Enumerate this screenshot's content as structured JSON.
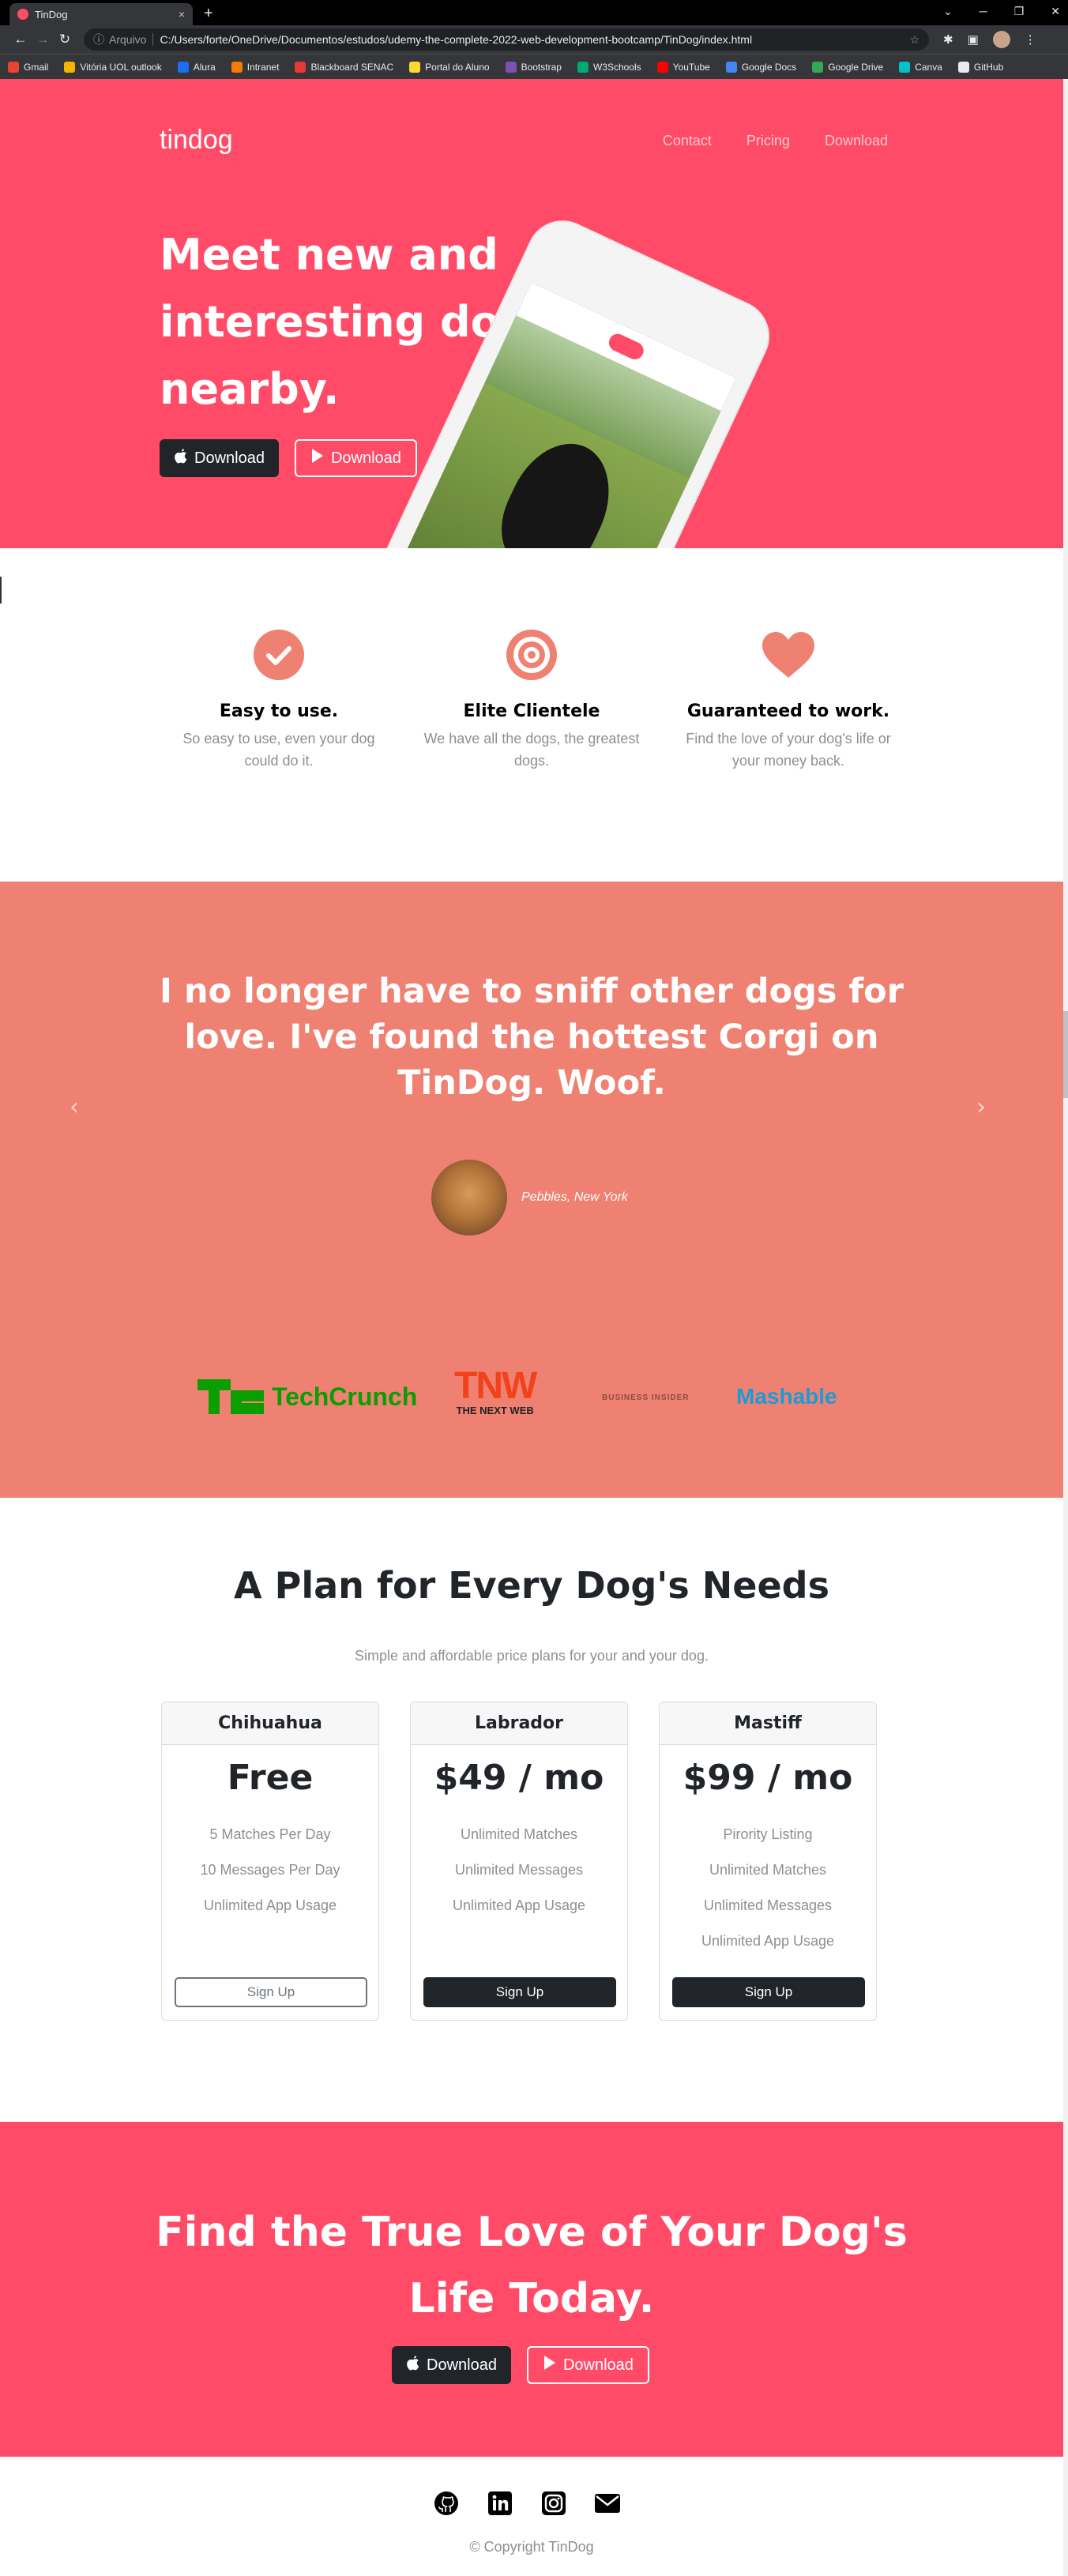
{
  "browser": {
    "tab_title": "TinDog",
    "tab_close": "×",
    "new_tab": "+",
    "url_scheme": "Arquivo",
    "url": "C:/Users/forte/OneDrive/Documentos/estudos/udemy-the-complete-2022-web-development-bootcamp/TinDog/index.html",
    "bookmarks": [
      {
        "label": "Gmail",
        "color": "#ea4335"
      },
      {
        "label": "Vitória UOL outlook",
        "color": "#f4b400"
      },
      {
        "label": "Alura",
        "color": "#1c6ef2"
      },
      {
        "label": "Intranet",
        "color": "#f57c00"
      },
      {
        "label": "Blackboard SENAC",
        "color": "#e53935"
      },
      {
        "label": "Portal do Aluno",
        "color": "#fdd835"
      },
      {
        "label": "Bootstrap",
        "color": "#7952b3"
      },
      {
        "label": "W3Schools",
        "color": "#04aa6d"
      },
      {
        "label": "YouTube",
        "color": "#ff0000"
      },
      {
        "label": "Google Docs",
        "color": "#4285f4"
      },
      {
        "label": "Google Drive",
        "color": "#34a853"
      },
      {
        "label": "Canva",
        "color": "#00c4cc"
      },
      {
        "label": "GitHub",
        "color": "#e8eaed"
      }
    ]
  },
  "hero": {
    "brand": "tindog",
    "nav": [
      "Contact",
      "Pricing",
      "Download"
    ],
    "title": "Meet new and interesting dogs nearby.",
    "btn_apple": "Download",
    "btn_play": "Download",
    "bg_color": "#ff4b67"
  },
  "features": [
    {
      "icon": "check-circle-icon",
      "title": "Easy to use.",
      "text": "So easy to use, even your dog could do it."
    },
    {
      "icon": "bullseye-icon",
      "title": "Elite Clientele",
      "text": "We have all the dogs, the greatest dogs."
    },
    {
      "icon": "heart-icon",
      "title": "Guaranteed to work.",
      "text": "Find the love of your dog's life or your money back."
    }
  ],
  "testimonial": {
    "quote": "I no longer have to sniff other dogs for love. I've found the hottest Corgi on TinDog. Woof.",
    "author": "Pebbles, New York",
    "prev": "‹",
    "next": "›",
    "logos": [
      "TechCrunch",
      "TNW",
      "THE NEXT WEB",
      "BUSINESS INSIDER",
      "Mashable"
    ],
    "bg_color": "#ef8172"
  },
  "pricing": {
    "title": "A Plan for Every Dog's Needs",
    "subtitle": "Simple and affordable price plans for your and your dog.",
    "plans": [
      {
        "name": "Chihuahua",
        "price": "Free",
        "features": [
          "5 Matches Per Day",
          "10 Messages Per Day",
          "Unlimited App Usage"
        ],
        "button": "Sign Up"
      },
      {
        "name": "Labrador",
        "price": "$49 / mo",
        "features": [
          "Unlimited Matches",
          "Unlimited Messages",
          "Unlimited App Usage"
        ],
        "button": "Sign Up"
      },
      {
        "name": "Mastiff",
        "price": "$99 / mo",
        "features": [
          "Pirority Listing",
          "Unlimited Matches",
          "Unlimited Messages",
          "Unlimited App Usage"
        ],
        "button": "Sign Up"
      }
    ]
  },
  "cta": {
    "title": "Find the True Love of Your Dog's Life Today.",
    "btn_apple": "Download",
    "btn_play": "Download"
  },
  "footer": {
    "icons": [
      "github-icon",
      "linkedin-icon",
      "instagram-icon",
      "envelope-icon"
    ],
    "copyright": "© Copyright TinDog"
  }
}
